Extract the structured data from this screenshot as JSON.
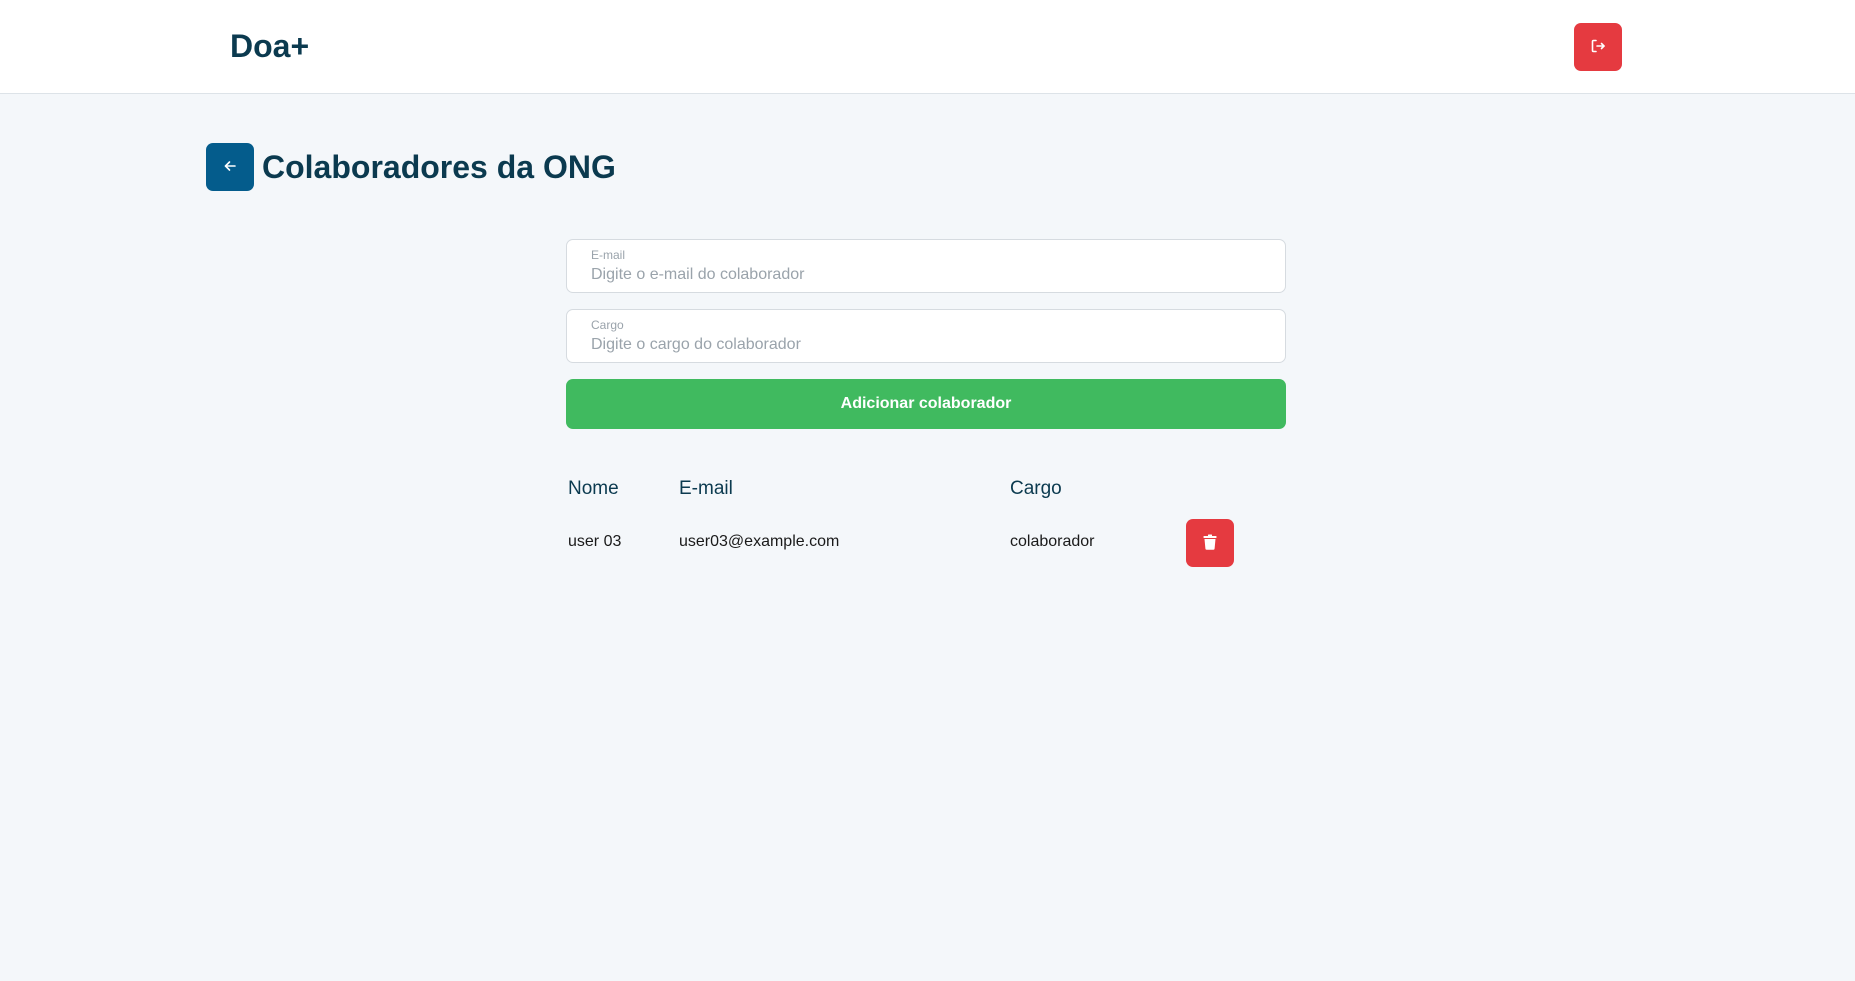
{
  "header": {
    "brand": "Doa+",
    "logout_icon": "logout-icon"
  },
  "page": {
    "back_icon": "arrow-left-icon",
    "title": "Colaboradores da ONG"
  },
  "form": {
    "email": {
      "label": "E-mail",
      "placeholder": "Digite o e-mail do colaborador",
      "value": ""
    },
    "cargo": {
      "label": "Cargo",
      "placeholder": "Digite o cargo do colaborador",
      "value": ""
    },
    "submit_label": "Adicionar colaborador"
  },
  "table": {
    "headers": [
      "Nome",
      "E-mail",
      "Cargo"
    ],
    "rows": [
      {
        "nome": "user 03",
        "email": "user03@example.com",
        "cargo": "colaborador",
        "action_icon": "trash-icon"
      }
    ]
  },
  "colors": {
    "brand_text": "#0b3a4f",
    "danger": "#e53a40",
    "primary": "#045c8c",
    "success": "#40ba5f",
    "background": "#f4f7fa"
  }
}
